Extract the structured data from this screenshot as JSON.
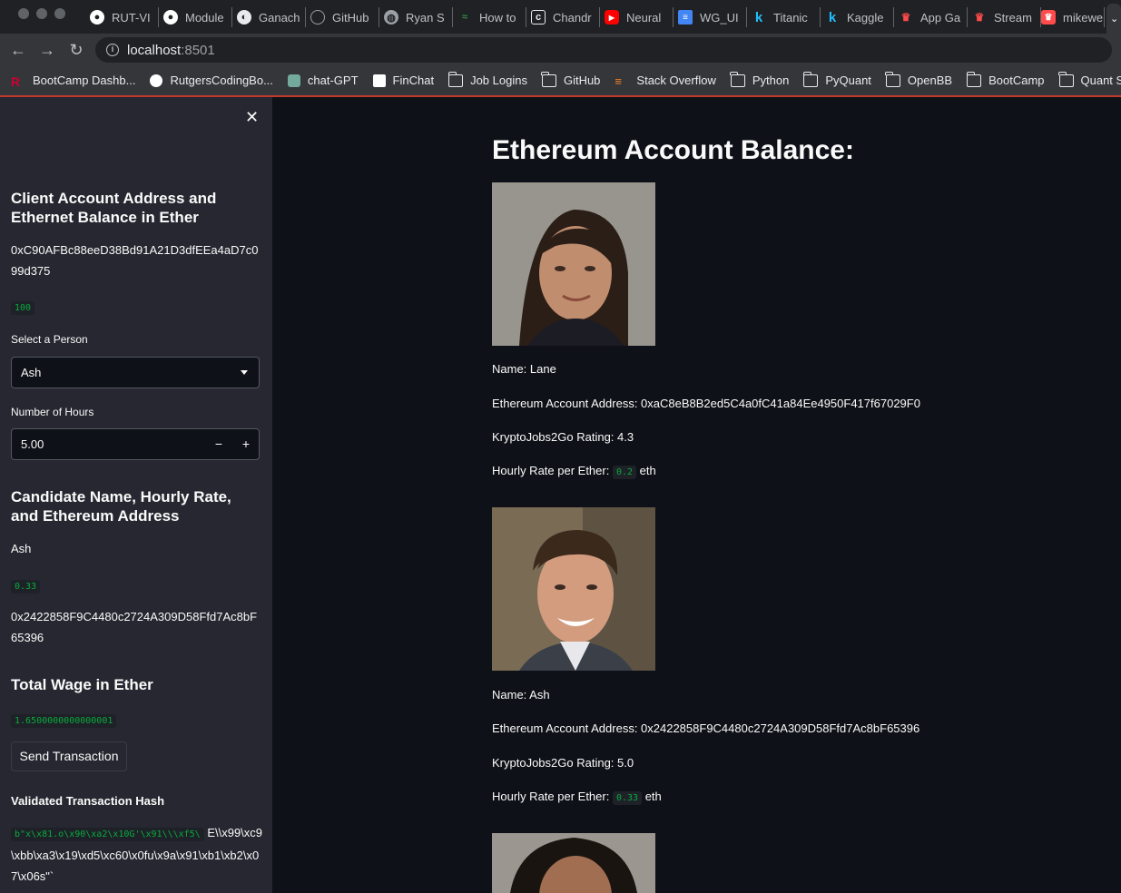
{
  "browser": {
    "tabs": [
      {
        "label": "RUT-VI",
        "icon": "github-icon"
      },
      {
        "label": "Module",
        "icon": "github-icon"
      },
      {
        "label": "Ganach",
        "icon": "ganache-icon"
      },
      {
        "label": "GitHub",
        "icon": "github-icon"
      },
      {
        "label": "Ryan S",
        "icon": "globe-icon"
      },
      {
        "label": "How to",
        "icon": "geeksforgeeks-icon"
      },
      {
        "label": "Chandr",
        "icon": "hexagon-icon"
      },
      {
        "label": "Neural",
        "icon": "youtube-icon"
      },
      {
        "label": "WG_UI",
        "icon": "docs-icon"
      },
      {
        "label": "Titanic",
        "icon": "kaggle-icon"
      },
      {
        "label": "Kaggle",
        "icon": "kaggle-icon"
      },
      {
        "label": "App Ga",
        "icon": "streamlit-icon"
      },
      {
        "label": "Stream",
        "icon": "streamlit-icon"
      },
      {
        "label": "mikewe",
        "icon": "streamlit-icon"
      }
    ],
    "url_host": "localhost",
    "url_port": ":8501",
    "bookmarks": [
      {
        "label": "BootCamp Dashb...",
        "icon": "rutgers-icon"
      },
      {
        "label": "RutgersCodingBo...",
        "icon": "github-icon"
      },
      {
        "label": "chat-GPT",
        "icon": "openai-icon"
      },
      {
        "label": "FinChat",
        "icon": "finchat-icon"
      },
      {
        "label": "Job Logins",
        "icon": "folder-icon"
      },
      {
        "label": "GitHub",
        "icon": "folder-icon"
      },
      {
        "label": "Stack Overflow",
        "icon": "stackoverflow-icon"
      },
      {
        "label": "Python",
        "icon": "folder-icon"
      },
      {
        "label": "PyQuant",
        "icon": "folder-icon"
      },
      {
        "label": "OpenBB",
        "icon": "folder-icon"
      },
      {
        "label": "BootCamp",
        "icon": "folder-icon"
      },
      {
        "label": "Quant Stu",
        "icon": "folder-icon"
      }
    ]
  },
  "sidebar": {
    "client_heading": "Client Account Address and Ethernet Balance in Ether",
    "client_address": "0xC90AFBc88eeD38Bd91A21D3dfEEa4aD7c099d375",
    "client_balance": "100",
    "select_label": "Select a Person",
    "select_value": "Ash",
    "hours_label": "Number of Hours",
    "hours_value": "5.00",
    "minus": "−",
    "plus": "+",
    "candidate_heading": "Candidate Name, Hourly Rate, and Ethereum Address",
    "candidate_name": "Ash",
    "candidate_rate": "0.33",
    "candidate_address": "0x2422858F9C4480c2724A309D58Ffd7Ac8bF65396",
    "wage_heading": "Total Wage in Ether",
    "wage_value": "1.6500000000000001",
    "send_button": "Send Transaction",
    "hash_label": "Validated Transaction Hash",
    "hash_code": "b\"x\\x81.o\\x90\\xa2\\x10G'\\x91\\\\\\xf5\\",
    "hash_rest": "E\\\\x99\\xc9\\xbb\\xa3\\x19\\xd5\\xc60\\x0fu\\x9a\\x91\\xb1\\xb2\\x07\\x06s\"`"
  },
  "main": {
    "heading": "Ethereum Account Balance:",
    "candidates": [
      {
        "name": "Name: Lane",
        "address": "Ethereum Account Address: 0xaC8eB8B2ed5C4a0fC41a84Ee4950F417f67029F0",
        "rating": "KryptoJobs2Go Rating: 4.3",
        "rate_label": "Hourly Rate per Ether:",
        "rate_value": "0.2",
        "rate_unit": "eth"
      },
      {
        "name": "Name: Ash",
        "address": "Ethereum Account Address: 0x2422858F9C4480c2724A309D58Ffd7Ac8bF65396",
        "rating": "KryptoJobs2Go Rating: 5.0",
        "rate_label": "Hourly Rate per Ether:",
        "rate_value": "0.33",
        "rate_unit": "eth"
      }
    ]
  }
}
